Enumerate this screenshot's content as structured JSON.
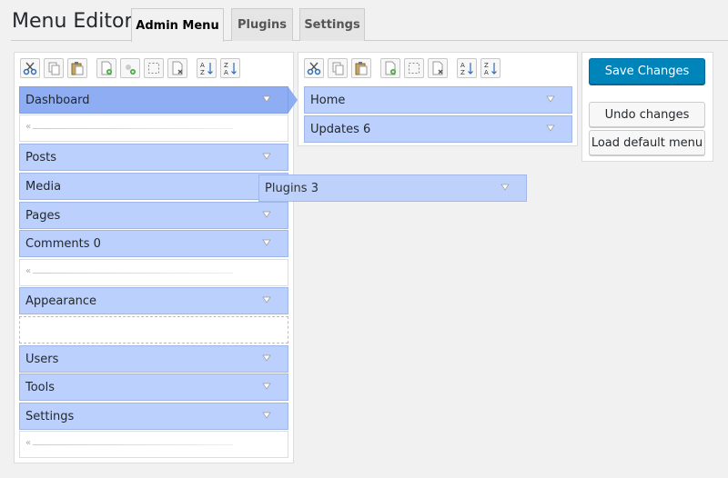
{
  "header": {
    "title": "Menu Editor",
    "tabs": [
      {
        "label": "Admin Menu",
        "active": true
      },
      {
        "label": "Plugins",
        "active": false
      },
      {
        "label": "Settings",
        "active": false
      }
    ]
  },
  "toolbar_icons": [
    "cut-icon",
    "copy-icon",
    "paste-icon",
    "new-item-icon",
    "new-submenu-icon",
    "new-separator-icon",
    "delete-icon",
    "sort-ascending-icon",
    "sort-descending-icon"
  ],
  "left_menu": {
    "items": [
      {
        "label": "Dashboard"
      },
      {
        "label": "Posts"
      },
      {
        "label": "Media"
      },
      {
        "label": "Pages"
      },
      {
        "label": "Comments 0"
      },
      {
        "label": "Appearance"
      },
      {
        "label": "Users"
      },
      {
        "label": "Tools"
      },
      {
        "label": "Settings"
      }
    ]
  },
  "submenu": {
    "items": [
      {
        "label": "Home"
      },
      {
        "label": "Updates 6"
      }
    ]
  },
  "dragging_item": {
    "label": "Plugins 3"
  },
  "actions": {
    "save": "Save Changes",
    "undo": "Undo changes",
    "load_default": "Load default menu"
  },
  "colors": {
    "item": "#bbd0fc",
    "item_selected": "#8fadf2",
    "primary": "#0085ba"
  }
}
